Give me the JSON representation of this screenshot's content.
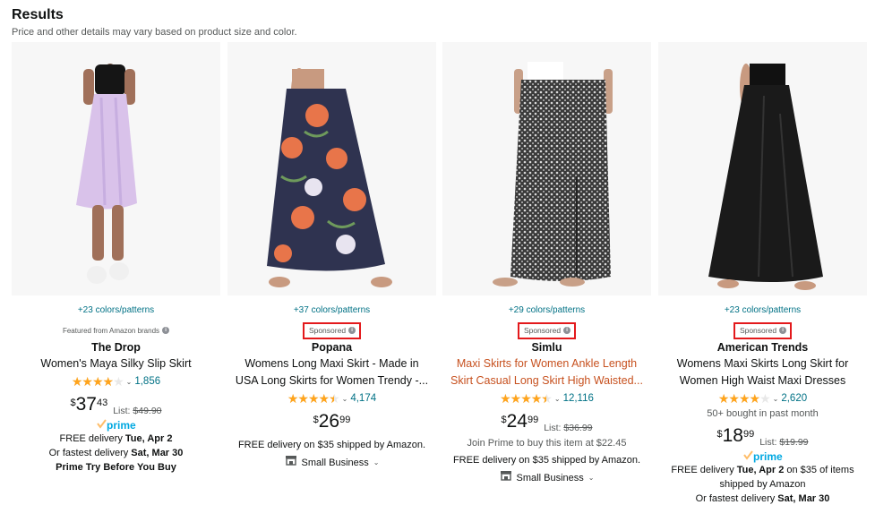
{
  "header": {
    "title": "Results",
    "subtitle": "Price and other details may vary based on product size and color."
  },
  "colors": {
    "link": "#007185",
    "sponsored_border": "#e3191c",
    "star": "#ffa41c",
    "orange_title": "#c7511f",
    "prime": "#00a8e1"
  },
  "products": [
    {
      "colors_link": "+23 colors/patterns",
      "badge": "Featured from Amazon brands",
      "brand": "The Drop",
      "title": "Women's Maya Silky Slip Skirt",
      "rating": 4.0,
      "rating_count": "1,856",
      "price_currency": "$",
      "price_whole": "37",
      "price_fraction": "43",
      "list_label": "List:",
      "list_price": "$49.90",
      "prime_label": "prime",
      "delivery_prefix": "FREE delivery",
      "delivery_date": "Tue, Apr 2",
      "fastest_prefix": "Or fastest delivery",
      "fastest_date": "Sat, Mar 30",
      "extra": "Prime Try Before You Buy"
    },
    {
      "colors_link": "+37 colors/patterns",
      "badge": "Sponsored",
      "brand": "Popana",
      "title_line1": "Womens Long Maxi Skirt - Made in",
      "title_line2": "USA Long Skirts for Women Trendy -...",
      "rating": 4.5,
      "rating_count": "4,174",
      "price_currency": "$",
      "price_whole": "26",
      "price_fraction": "99",
      "delivery": "FREE delivery on $35 shipped by Amazon.",
      "small_business": "Small Business"
    },
    {
      "colors_link": "+29 colors/patterns",
      "badge": "Sponsored",
      "brand": "Simlu",
      "title_line1": "Maxi Skirts for Women Ankle Length",
      "title_line2": "Skirt Casual Long Skirt High Waisted...",
      "rating": 4.5,
      "rating_count": "12,116",
      "price_currency": "$",
      "price_whole": "24",
      "price_fraction": "99",
      "list_label": "List:",
      "list_price": "$36.99",
      "prime_offer": "Join Prime to buy this item at $22.45",
      "delivery": "FREE delivery on $35 shipped by Amazon.",
      "small_business": "Small Business"
    },
    {
      "colors_link": "+23 colors/patterns",
      "badge": "Sponsored",
      "brand": "American Trends",
      "title_line1": "Womens Maxi Skirts Long Skirt for",
      "title_line2": "Women High Waist Maxi Dresses",
      "rating": 4.0,
      "rating_count": "2,620",
      "bought": "50+ bought in past month",
      "price_currency": "$",
      "price_whole": "18",
      "price_fraction": "99",
      "list_label": "List:",
      "list_price": "$19.99",
      "prime_label": "prime",
      "delivery_prefix": "FREE delivery",
      "delivery_date": "Tue, Apr 2",
      "delivery_suffix": "on $35 of items",
      "delivery_line2": "shipped by Amazon",
      "fastest_prefix": "Or fastest delivery",
      "fastest_date": "Sat, Mar 30"
    }
  ]
}
